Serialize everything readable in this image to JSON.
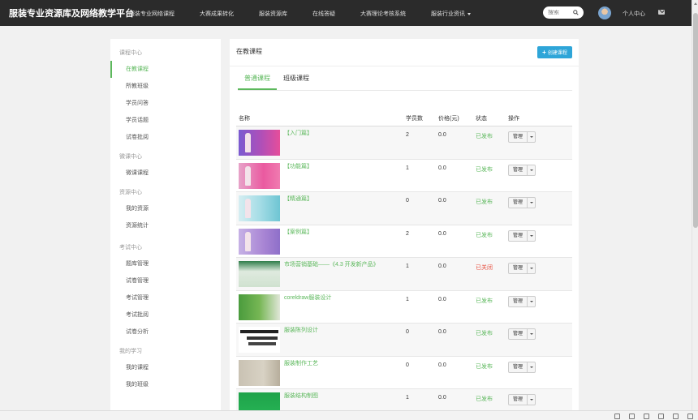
{
  "brand": "服装专业资源库及网络教学平台",
  "nav": [
    {
      "label": "服装专业网络课程"
    },
    {
      "label": "大赛成果转化"
    },
    {
      "label": "服装资源库"
    },
    {
      "label": "在线答疑"
    },
    {
      "label": "大赛理论考核系统"
    },
    {
      "label": "服装行业资讯"
    }
  ],
  "search": {
    "placeholder": "搜索"
  },
  "user": {
    "center_label": "个人中心"
  },
  "sidebar": {
    "groups": [
      {
        "title": "课程中心",
        "items": [
          "在教课程",
          "所教班级",
          "学员问答",
          "学员话题",
          "试卷批阅"
        ]
      },
      {
        "title": "微课中心",
        "items": [
          "微课课程"
        ]
      },
      {
        "title": "资源中心",
        "items": [
          "我的资源",
          "资源统计"
        ]
      },
      {
        "title": "考试中心",
        "items": [
          "题库管理",
          "试卷管理",
          "考试管理",
          "考试批阅",
          "试卷分析"
        ]
      },
      {
        "title": "我的学习",
        "items": [
          "我的课程",
          "我的班级"
        ]
      }
    ],
    "active": "在教课程"
  },
  "panel": {
    "title": "在教课程",
    "create_label": "创建课程",
    "tabs": [
      "普通课程",
      "班级课程"
    ],
    "active_tab": "普通课程"
  },
  "table": {
    "headers": {
      "name": "名称",
      "students": "学员数",
      "price": "价格(元)",
      "status": "状态",
      "op": "操作"
    },
    "op_label": "管理",
    "rows": [
      {
        "name": "【入门篇】",
        "students": "2",
        "price": "0.0",
        "status": "已发布",
        "status_type": "published",
        "thumb": "t-pink"
      },
      {
        "name": "【功能篇】",
        "students": "1",
        "price": "0.0",
        "status": "已发布",
        "status_type": "published",
        "thumb": "t-pink2"
      },
      {
        "name": "【精通篇】",
        "students": "0",
        "price": "0.0",
        "status": "已发布",
        "status_type": "published",
        "thumb": "t-teal"
      },
      {
        "name": "【案例篇】",
        "students": "2",
        "price": "0.0",
        "status": "已发布",
        "status_type": "published",
        "thumb": "t-lav"
      },
      {
        "name": "市场营销基础——《4.3 开发新产品》",
        "students": "1",
        "price": "0.0",
        "status": "已关闭",
        "status_type": "closed",
        "thumb": "t-green"
      },
      {
        "name": "coreldraw服装设计",
        "students": "1",
        "price": "0.0",
        "status": "已发布",
        "status_type": "published",
        "thumb": "t-cdr"
      },
      {
        "name": "服装陈列设计",
        "students": "0",
        "price": "0.0",
        "status": "已发布",
        "status_type": "published",
        "thumb": "t-fash"
      },
      {
        "name": "服装制作工艺",
        "students": "0",
        "price": "0.0",
        "status": "已发布",
        "status_type": "published",
        "thumb": "t-prod"
      },
      {
        "name": "服装结构制图",
        "students": "1",
        "price": "0.0",
        "status": "已发布",
        "status_type": "published",
        "thumb": "t-pat"
      }
    ]
  },
  "colors": {
    "accent": "#5cb85c",
    "closed": "#e74c3c",
    "primary_btn": "#2ea5d8",
    "topbar": "#2b2b2b"
  }
}
